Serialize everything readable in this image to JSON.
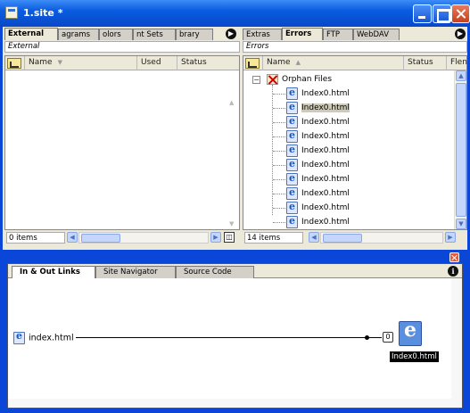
{
  "window": {
    "title": "1.site *"
  },
  "left_panel": {
    "tabs": [
      "External",
      "Diagrams",
      "Colors",
      "Font Sets",
      "Library"
    ],
    "tab_display": [
      "External",
      "agrams",
      "olors",
      "nt Sets",
      "brary"
    ],
    "path": "External",
    "columns": [
      "Name",
      "Used",
      "Status"
    ],
    "count": "0 items"
  },
  "right_panel": {
    "tabs": [
      "Extras",
      "Errors",
      "FTP",
      "WebDAV"
    ],
    "path": "Errors",
    "columns": [
      "Name",
      "Status",
      "Flen"
    ],
    "tree_root": "Orphan Files",
    "files": [
      "Index0.html",
      "Index0.html",
      "Index0.html",
      "Index0.html",
      "Index0.html",
      "Index0.html",
      "Index0.html",
      "Index0.html",
      "Index0.html",
      "Index0.html",
      "Index0.html"
    ],
    "count": "14 items"
  },
  "bottom_panel": {
    "tabs": [
      "In & Out Links",
      "Site Navigator",
      "Source Code"
    ],
    "source_file": "index.html",
    "link_count": "0",
    "target_file": "Index0.html"
  },
  "colors": {
    "title_bar": "#0a5ce0",
    "panel_bg": "#ece9d8",
    "selection": "#cfcab8"
  }
}
